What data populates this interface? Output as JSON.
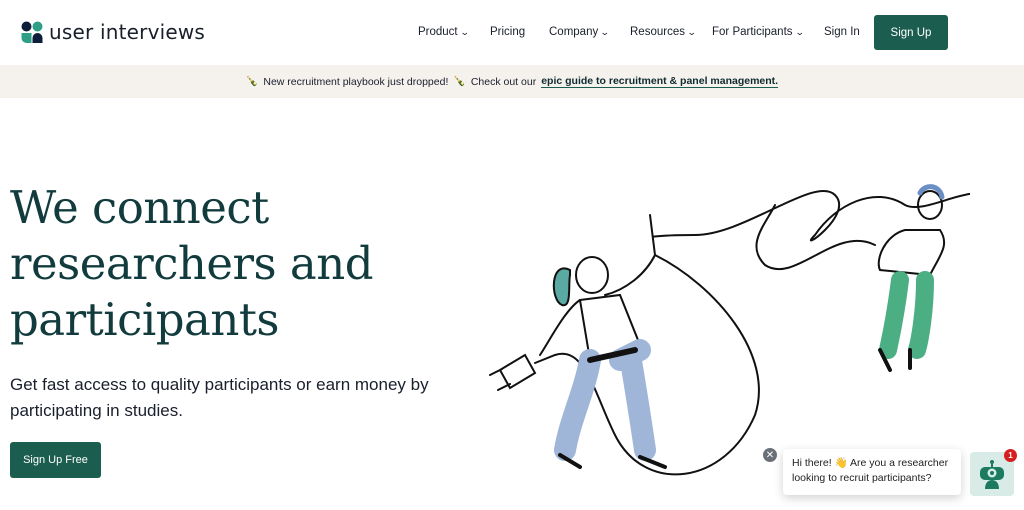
{
  "brand": {
    "name": "user interviews",
    "colors": {
      "primary": "#1b5d4f",
      "dark": "#0e2a2f",
      "accent_teal": "#2f9e86"
    }
  },
  "nav": {
    "items": [
      {
        "label": "Product",
        "dropdown": true
      },
      {
        "label": "Pricing",
        "dropdown": false
      },
      {
        "label": "Company",
        "dropdown": true
      },
      {
        "label": "Resources",
        "dropdown": true
      },
      {
        "label": "For Participants",
        "dropdown": true
      }
    ],
    "sign_in": "Sign In",
    "sign_up": "Sign Up"
  },
  "banner": {
    "icon": "bottle-icon",
    "emoji": "🍾",
    "text1": "New recruitment playbook just dropped!",
    "text2": "Check out our",
    "link": "epic guide to recruitment & panel management."
  },
  "hero": {
    "title": "We connect researchers and participants",
    "subtitle": "Get fast access to quality participants or earn money by participating in studies.",
    "cta": "Sign Up Free"
  },
  "chat": {
    "message": "Hi there! 👋 Are you a researcher looking to recruit participants?",
    "badge": "1",
    "close_icon": "close-icon",
    "launcher_icon": "robot-icon"
  }
}
